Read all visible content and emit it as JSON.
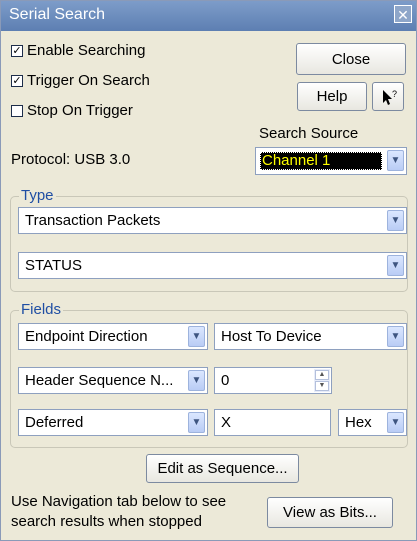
{
  "window": {
    "title": "Serial Search",
    "close_glyph": "✕"
  },
  "options": {
    "enable": {
      "label": "Enable Searching",
      "checked": true
    },
    "trigger": {
      "label": "Trigger On Search",
      "checked": true
    },
    "stop": {
      "label": "Stop On Trigger",
      "checked": false
    }
  },
  "buttons": {
    "close": "Close",
    "help": "Help",
    "context_help_icon": "arrow-question-icon",
    "edit_sequence": "Edit as Sequence...",
    "view_bits": "View as Bits..."
  },
  "search_source": {
    "label": "Search Source",
    "value": "Channel 1",
    "value_color": "#ffff00",
    "bg_color": "#000000"
  },
  "protocol": "Protocol: USB 3.0",
  "type": {
    "group_label": "Type",
    "packet": "Transaction Packets",
    "status": "STATUS"
  },
  "fields": {
    "group_label": "Fields",
    "endpoint_direction": "Endpoint Direction",
    "direction_value": "Host To Device",
    "header_seq": "Header Sequence N...",
    "header_value": "0",
    "deferred": "Deferred",
    "deferred_value": "X",
    "format": "Hex"
  },
  "footer_text_line1": "Use Navigation tab below to see",
  "footer_text_line2": "search results when stopped"
}
